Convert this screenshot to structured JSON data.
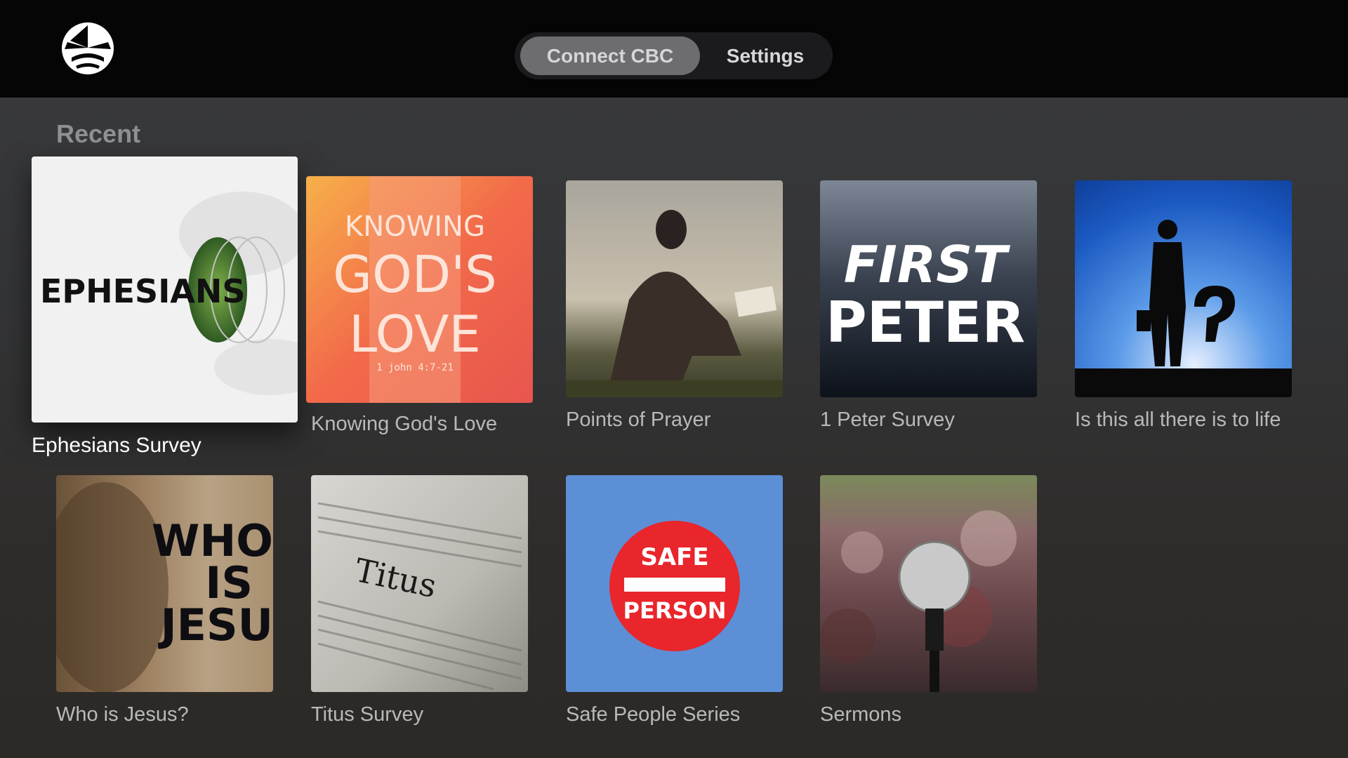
{
  "header": {
    "nav": [
      {
        "label": "Connect CBC",
        "selected": true
      },
      {
        "label": "Settings",
        "selected": false
      }
    ]
  },
  "section": {
    "title": "Recent"
  },
  "tiles": [
    {
      "label": "Ephesians Survey",
      "art_text": "EPHESIANS",
      "focused": true
    },
    {
      "label": "Knowing God's Love",
      "art_lines": [
        "KNOWING",
        "GOD'S",
        "LOVE"
      ],
      "art_ref": "1 john 4:7-21"
    },
    {
      "label": "Points of Prayer"
    },
    {
      "label": "1 Peter Survey",
      "art_lines": [
        "FIRST",
        "PETER"
      ]
    },
    {
      "label": "Is this all there is to life"
    },
    {
      "label": "Who is Jesus?",
      "art_lines": [
        "WHO",
        "IS",
        "JESU"
      ]
    },
    {
      "label": "Titus Survey",
      "art_text": "Titus"
    },
    {
      "label": "Safe People Series",
      "art_lines": [
        "SAFE",
        "PERSON"
      ]
    },
    {
      "label": "Sermons"
    }
  ],
  "colors": {
    "accent_red": "#e8262c",
    "safe_blue": "#5c8fd6",
    "knowing_orange": "#f26a4a"
  }
}
